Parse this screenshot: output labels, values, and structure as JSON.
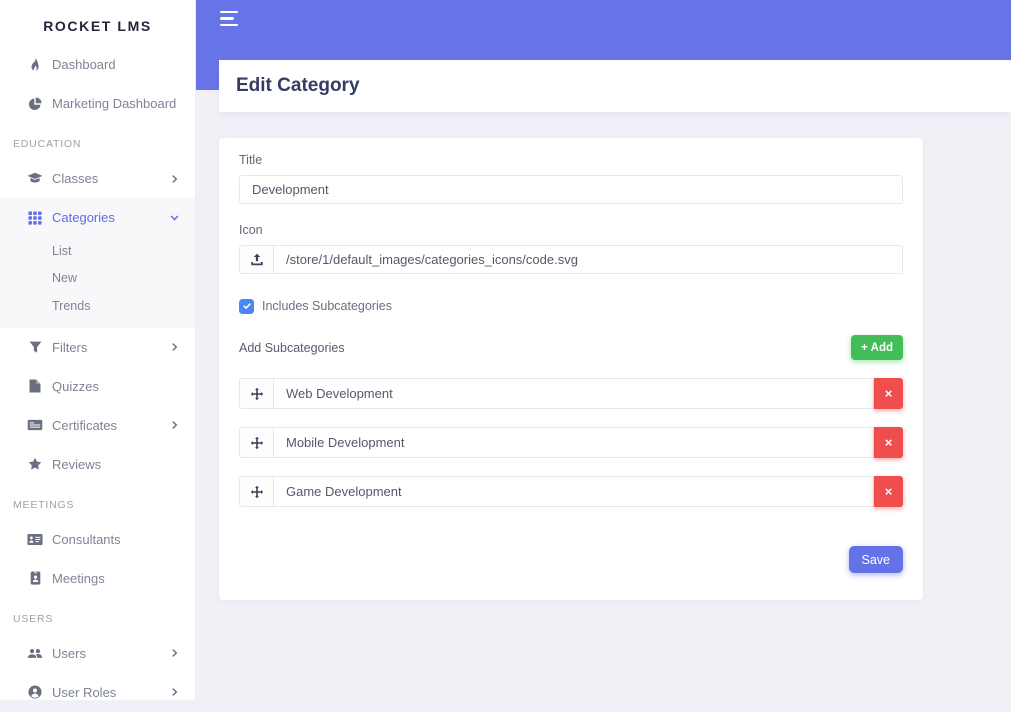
{
  "brand": "ROCKET LMS",
  "topbar": {
    "menu_icon": "hamburger-icon"
  },
  "page": {
    "title": "Edit Category"
  },
  "sidebar": {
    "items": [
      {
        "kind": "item",
        "icon": "flame-icon",
        "label": "Dashboard"
      },
      {
        "kind": "item",
        "icon": "pie-chart-icon",
        "label": "Marketing Dashboard"
      },
      {
        "kind": "section",
        "label": "EDUCATION"
      },
      {
        "kind": "item",
        "icon": "graduation-cap-icon",
        "label": "Classes",
        "chevron": "right"
      },
      {
        "kind": "item",
        "icon": "grid-icon",
        "label": "Categories",
        "chevron": "down",
        "active": true
      },
      {
        "kind": "subitem",
        "label": "List"
      },
      {
        "kind": "subitem",
        "label": "New"
      },
      {
        "kind": "subitem",
        "label": "Trends"
      },
      {
        "kind": "item",
        "icon": "filter-icon",
        "label": "Filters",
        "chevron": "right"
      },
      {
        "kind": "item",
        "icon": "file-icon",
        "label": "Quizzes"
      },
      {
        "kind": "item",
        "icon": "certificate-icon",
        "label": "Certificates",
        "chevron": "right"
      },
      {
        "kind": "item",
        "icon": "star-icon",
        "label": "Reviews"
      },
      {
        "kind": "section",
        "label": "MEETINGS"
      },
      {
        "kind": "item",
        "icon": "id-card-icon",
        "label": "Consultants"
      },
      {
        "kind": "item",
        "icon": "badge-icon",
        "label": "Meetings"
      },
      {
        "kind": "section",
        "label": "USERS"
      },
      {
        "kind": "item",
        "icon": "users-icon",
        "label": "Users",
        "chevron": "right"
      },
      {
        "kind": "item",
        "icon": "user-circle-icon",
        "label": "User Roles",
        "chevron": "right"
      }
    ]
  },
  "form": {
    "title_label": "Title",
    "title_value": "Development",
    "icon_label": "Icon",
    "icon_value": "/store/1/default_images/categories_icons/code.svg",
    "includes_subcategories_label": "Includes Subcategories",
    "includes_subcategories_checked": true,
    "add_subcategories_label": "Add Subcategories",
    "add_button_label": "+ Add",
    "subcategories": [
      "Web Development",
      "Mobile Development",
      "Game Development"
    ],
    "remove_button_label": "×",
    "save_button_label": "Save"
  },
  "colors": {
    "topbar": "#6674e8",
    "active_nav": "#5b6fe6",
    "checkbox_blue": "#4a86f5",
    "success_green": "#43bd57",
    "danger_red": "#f04d4d",
    "save_purple": "#6372e6",
    "page_background": "#f0f1f7"
  }
}
